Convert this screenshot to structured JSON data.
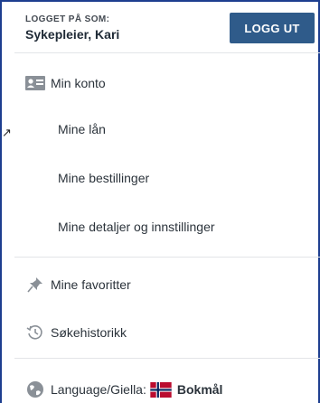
{
  "header": {
    "logged_label": "LOGGET PÅ SOM:",
    "user_name": "Sykepleier, Kari",
    "logout_label": "LOGG UT"
  },
  "menu": {
    "account": "Min konto",
    "loans": "Mine lån",
    "orders": "Mine bestillinger",
    "details": "Mine detaljer og innstillinger",
    "favorites": "Mine favoritter",
    "history": "Søkehistorikk",
    "language_label": "Language/Giella:",
    "language_value": "Bokmål"
  },
  "colors": {
    "accent": "#2f5b8a",
    "frame": "#1d3e8f"
  },
  "icons": {
    "account": "id-card-icon",
    "favorites": "pin-icon",
    "history": "history-icon",
    "language": "globe-icon",
    "flag": "norway-flag-icon"
  }
}
